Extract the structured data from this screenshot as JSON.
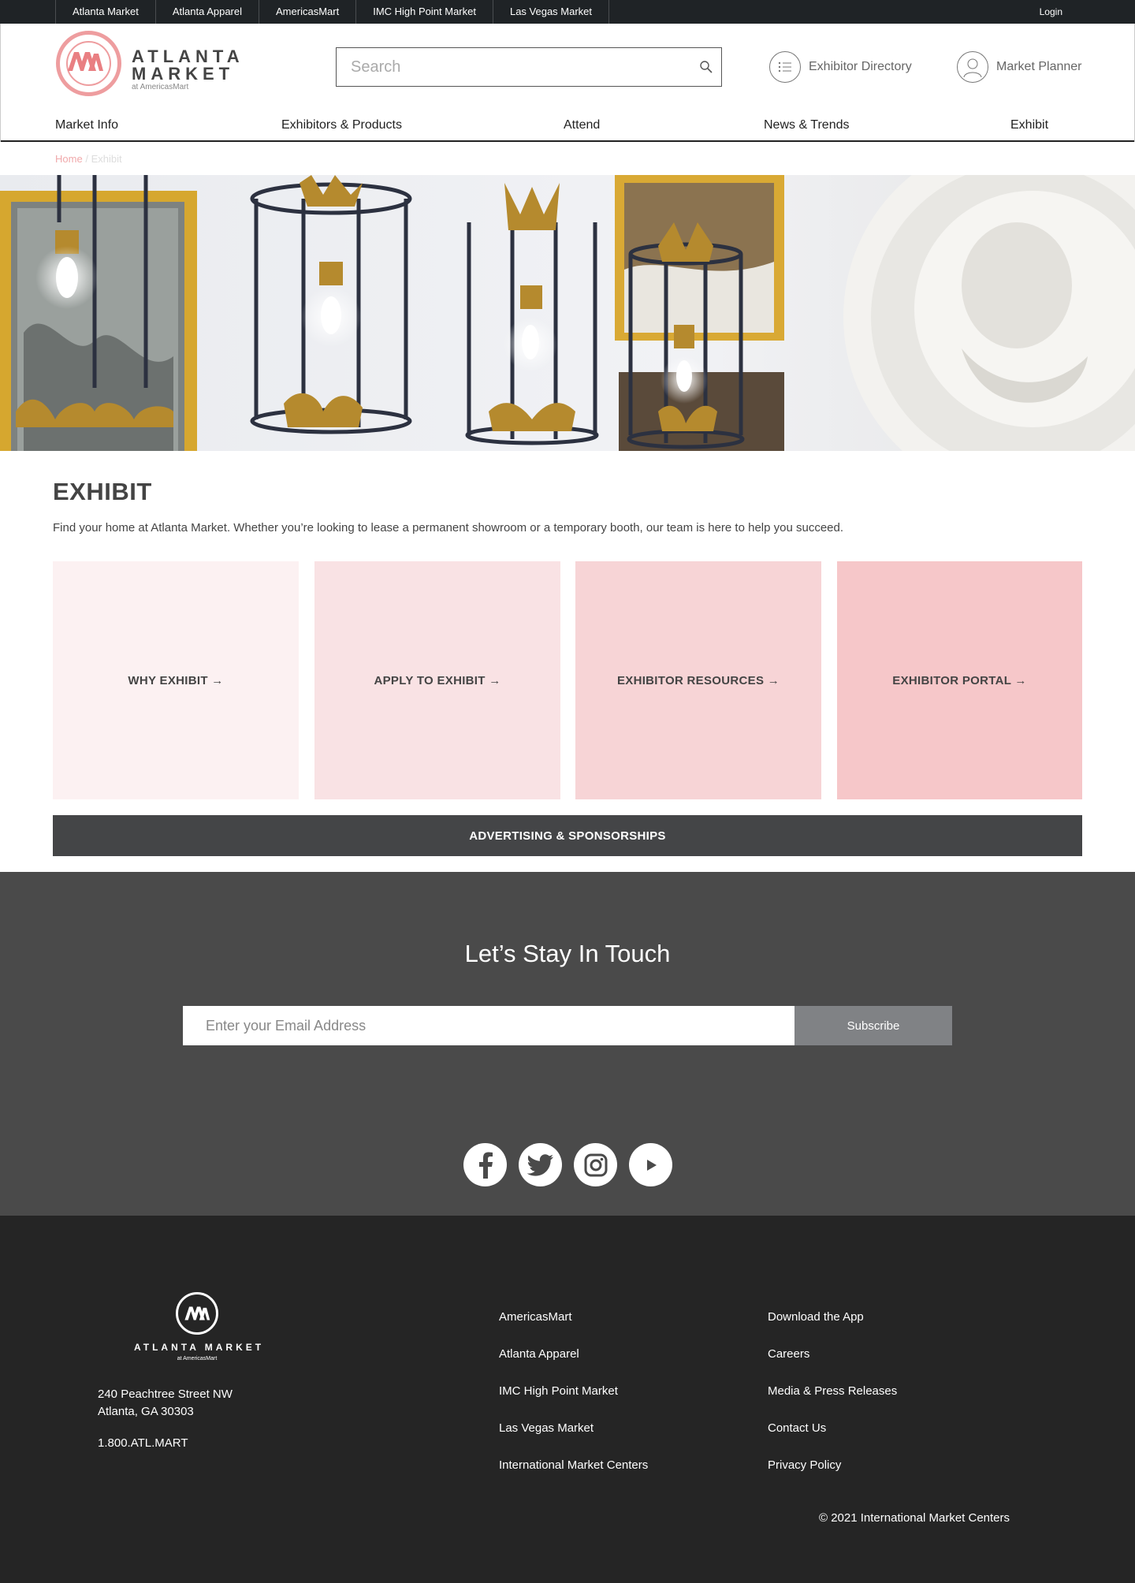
{
  "topbar": {
    "sites": [
      "Atlanta Market",
      "Atlanta Apparel",
      "AmericasMart",
      "IMC High Point Market",
      "Las Vegas Market"
    ],
    "login": "Login"
  },
  "header": {
    "logo_line1": "ATLANTA",
    "logo_line2": "MARKET",
    "logo_sub": "at AmericasMart",
    "search_placeholder": "Search",
    "exhibitor_directory": "Exhibitor Directory",
    "market_planner": "Market Planner"
  },
  "nav": [
    "Market Info",
    "Exhibitors & Products",
    "Attend",
    "News & Trends",
    "Exhibit"
  ],
  "breadcrumb": {
    "home": "Home",
    "sep": "/",
    "current": "Exhibit"
  },
  "main": {
    "title": "EXHIBIT",
    "intro": "Find your home at Atlanta Market. Whether you’re looking to lease a permanent showroom or a temporary booth, our team is here to help you succeed.",
    "tiles": [
      {
        "label": "WHY EXHIBIT →",
        "color": "#fcf1f2"
      },
      {
        "label": "APPLY TO EXHIBIT →",
        "color": "#f9e2e4"
      },
      {
        "label": "EXHIBITOR RESOURCES →",
        "color": "#f7d4d6"
      },
      {
        "label": "EXHIBITOR PORTAL →",
        "color": "#f6c7c9"
      }
    ],
    "ad_bar": "ADVERTISING & SPONSORSHIPS"
  },
  "newsletter": {
    "heading": "Let’s Stay In Touch",
    "email_placeholder": "Enter your Email Address",
    "subscribe": "Subscribe",
    "social_icons": [
      "facebook-icon",
      "twitter-icon",
      "instagram-icon",
      "youtube-icon"
    ]
  },
  "footer": {
    "logo_text": "ATLANTA MARKET",
    "logo_sub": "at AmericasMart",
    "address_line1": "240 Peachtree Street NW",
    "address_line2": "Atlanta, GA 30303",
    "phone": "1.800.ATL.MART",
    "col1": [
      "AmericasMart",
      "Atlanta Apparel",
      "IMC High Point Market",
      "Las Vegas Market",
      "International Market Centers"
    ],
    "col2": [
      "Download the App",
      "Careers",
      "Media & Press Releases",
      "Contact Us",
      "Privacy Policy"
    ],
    "copyright": "© 2021 International Market Centers"
  },
  "colors": {
    "brand_pink": "#ee9d9f",
    "topbar": "#1f2326",
    "newsletter_bg": "#4a4a4a",
    "footer_bg": "#252525",
    "ad_bar_bg": "#444547"
  }
}
